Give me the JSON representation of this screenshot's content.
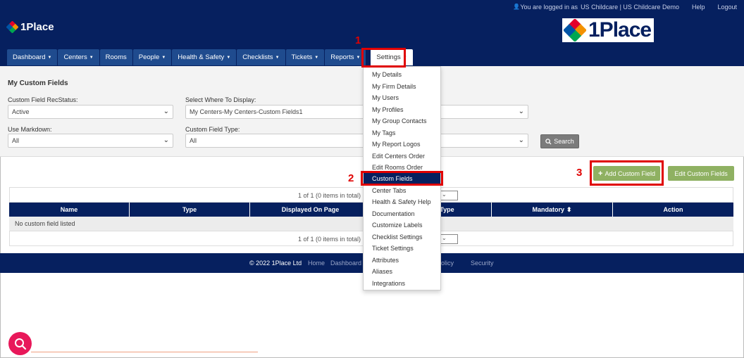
{
  "topbar": {
    "user_icon": "user-icon",
    "logged_in_text": "You are logged in as",
    "user_name": "US Childcare | US Childcare Demo",
    "help": "Help",
    "logout": "Logout"
  },
  "brand": {
    "name": "1Place",
    "logo_colors": [
      "#e4002b",
      "#f39200",
      "#00a651",
      "#0054a6"
    ]
  },
  "nav": {
    "items": [
      {
        "label": "Dashboard",
        "caret": "▼"
      },
      {
        "label": "Centers",
        "caret": "▼"
      },
      {
        "label": "Rooms",
        "caret": ""
      },
      {
        "label": "People",
        "caret": "▼"
      },
      {
        "label": "Health & Safety",
        "caret": "▼"
      },
      {
        "label": "Checklists",
        "caret": "▼"
      },
      {
        "label": "Tickets",
        "caret": "▼"
      },
      {
        "label": "Reports",
        "caret": "▼"
      }
    ],
    "active": {
      "label": "Settings",
      "caret": "▼"
    }
  },
  "filters": {
    "title": "My Custom Fields",
    "recstatus_label": "Custom Field RecStatus:",
    "recstatus_value": "Active",
    "display_label": "Select Where To Display:",
    "display_value": "My Centers-My Centers-Custom Fields1",
    "markdown_label": "Use Markdown:",
    "markdown_value": "All",
    "type_label": "Custom Field Type:",
    "type_value": "All",
    "search_label": "Search"
  },
  "actions": {
    "add_label": "Add Custom Field",
    "edit_label": "Edit Custom Fields"
  },
  "table": {
    "pager_text": "1 of 1 (0 items in total)",
    "columns": [
      "Name",
      "Type",
      "Displayed On Page",
      "Type",
      "Mandatory",
      "Action"
    ],
    "mandatory_sort": "⬍",
    "empty": "No custom field listed"
  },
  "footer": {
    "copyright": "© 2022 1Place Ltd",
    "links": [
      "Home",
      "Dashboard"
    ],
    "links_right": [
      "Privacy Policy",
      "Security"
    ]
  },
  "settings_menu": [
    "My Details",
    "My Firm Details",
    "My Users",
    "My Profiles",
    "My Group Contacts",
    "My Tags",
    "My Report Logos",
    "Edit Centers Order",
    "Edit Rooms Order",
    "Custom Fields",
    "Center Tabs",
    "Health & Safety Help",
    "Documentation",
    "Customize Labels",
    "Checklist Settings",
    "Ticket Settings",
    "Attributes",
    "Aliases",
    "Integrations"
  ],
  "annotations": [
    "1",
    "2",
    "3"
  ],
  "colors": {
    "navy": "#06205f",
    "nav_tab": "#1f4b8e",
    "green": "#8fb162",
    "highlight": "#e00000"
  }
}
